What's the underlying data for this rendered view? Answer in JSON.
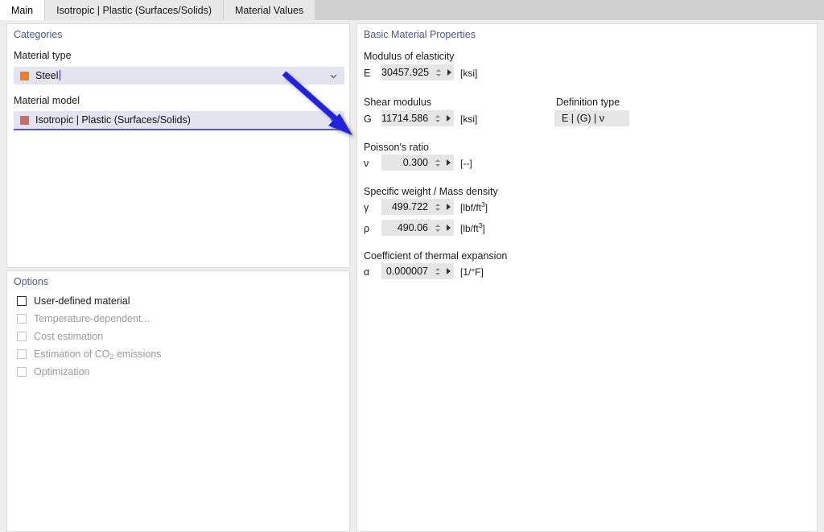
{
  "tabs": [
    {
      "label": "Main",
      "active": true
    },
    {
      "label": "Isotropic | Plastic (Surfaces/Solids)",
      "active": false
    },
    {
      "label": "Material Values",
      "active": false
    }
  ],
  "categories_panel": {
    "title": "Categories",
    "material_type": {
      "label": "Material type",
      "value": "Steel",
      "swatch_color": "#ED7D31",
      "caret_icon": "chevron-down-icon"
    },
    "material_model": {
      "label": "Material model",
      "value": "Isotropic | Plastic (Surfaces/Solids)",
      "swatch_color": "#C0706E",
      "underline_color": "#5B5B9E",
      "caret_icon": "chevron-down-icon"
    }
  },
  "options_panel": {
    "title": "Options",
    "items": [
      {
        "label": "User-defined material",
        "checked": false,
        "disabled": false
      },
      {
        "label": "Temperature-dependent...",
        "checked": false,
        "disabled": true
      },
      {
        "label": "Cost estimation",
        "checked": false,
        "disabled": true
      },
      {
        "label": "Estimation of CO2 emissions",
        "label_html": "Estimation of CO<sub>2</sub> emissions",
        "checked": false,
        "disabled": true
      },
      {
        "label": "Optimization",
        "checked": false,
        "disabled": true
      }
    ]
  },
  "basic_panel": {
    "title": "Basic Material Properties",
    "groups": [
      {
        "label": "Modulus of elasticity",
        "rows": [
          {
            "symbol": "E",
            "value": "30457.925",
            "unit": "[ksi]"
          }
        ]
      },
      {
        "label": "Shear modulus",
        "rows": [
          {
            "symbol": "G",
            "value": "11714.586",
            "unit": "[ksi]"
          }
        ]
      },
      {
        "label": "Poisson's ratio",
        "rows": [
          {
            "symbol": "ν",
            "value": "0.300",
            "unit": "[--]"
          }
        ]
      },
      {
        "label": "Specific weight / Mass density",
        "rows": [
          {
            "symbol": "γ",
            "value": "499.722",
            "unit": "[lbf/ft3]",
            "unit_sup": "3",
            "unit_base": "[lbf/ft",
            "unit_tail": "]"
          },
          {
            "symbol": "ρ",
            "value": "490.06",
            "unit": "[lb/ft3]",
            "unit_sup": "3",
            "unit_base": "[lb/ft",
            "unit_tail": "]"
          }
        ]
      },
      {
        "label": "Coefficient of thermal expansion",
        "rows": [
          {
            "symbol": "α",
            "value": "0.000007",
            "unit": "[1/°F]"
          }
        ]
      }
    ],
    "definition_type": {
      "label": "Definition type",
      "value": "E | (G) | ν"
    }
  },
  "annotation": {
    "arrow_color": "#2020DD",
    "name": "material-model-pointer-arrow"
  }
}
